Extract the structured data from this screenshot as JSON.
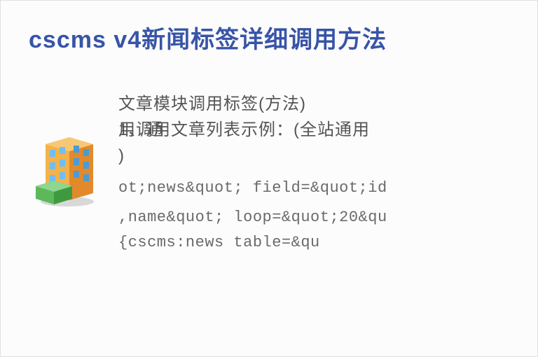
{
  "title": "cscms v4新闻标签详细调用方法",
  "subtitle": "文章模块调用标签(方法)",
  "line2": "用调用文章列表示例：(全站通用",
  "line2_overlay": "1、通",
  "line3": ")",
  "code_line1": "ot;news&quot; field=&quot;id",
  "code_line2": ",name&quot; loop=&quot;20&qu",
  "code_line3": "{cscms:news table=&qu"
}
